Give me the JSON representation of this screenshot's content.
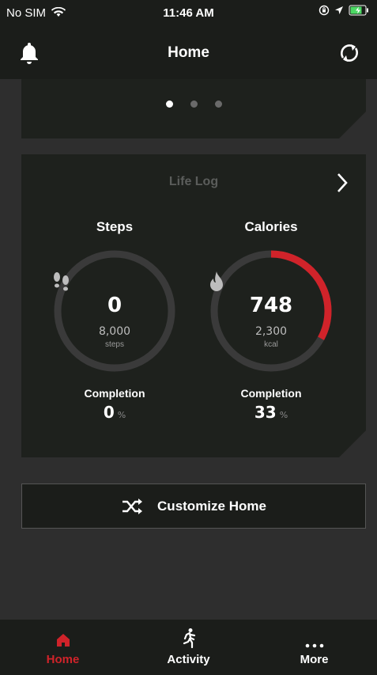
{
  "status": {
    "carrier": "No SIM",
    "time": "11:46 AM"
  },
  "nav": {
    "title": "Home"
  },
  "carousel": {
    "page_count": 3,
    "active_index": 0
  },
  "life_log": {
    "title": "Life Log",
    "steps": {
      "label": "Steps",
      "value": "0",
      "goal": "8,000",
      "unit": "steps",
      "completion_label": "Completion",
      "completion": "0",
      "completion_unit": "%",
      "progress": 0
    },
    "calories": {
      "label": "Calories",
      "value": "748",
      "goal": "2,300",
      "unit": "kcal",
      "completion_label": "Completion",
      "completion": "33",
      "completion_unit": "%",
      "progress": 0.33
    }
  },
  "customize": {
    "label": "Customize Home"
  },
  "tabs": [
    {
      "label": "Home",
      "icon": "home-icon",
      "active": true
    },
    {
      "label": "Activity",
      "icon": "runner-icon",
      "active": false
    },
    {
      "label": "More",
      "icon": "more-icon",
      "active": false
    }
  ],
  "colors": {
    "accent": "#d0232a",
    "ring_track": "#3a3a3a",
    "card": "#1e211d",
    "background": "#2e2e2e"
  }
}
